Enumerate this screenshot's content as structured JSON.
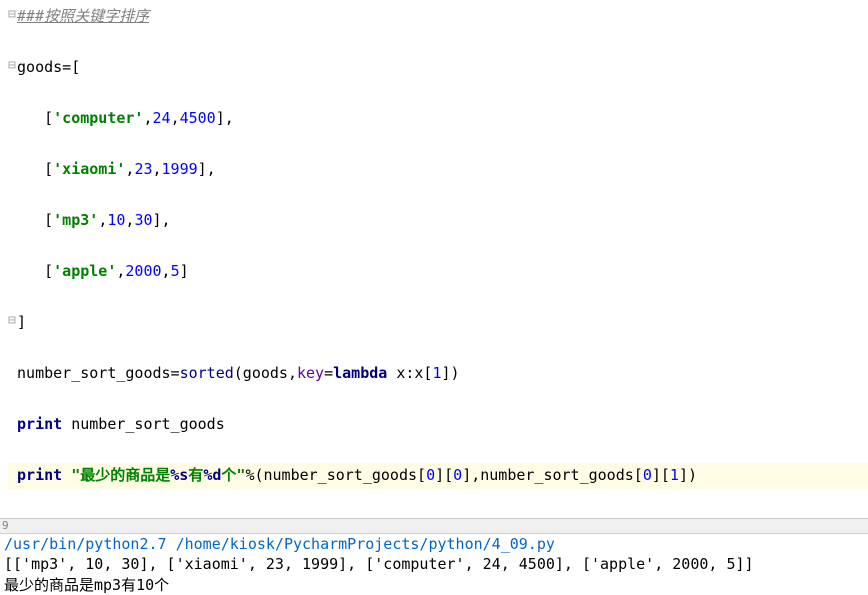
{
  "editor": {
    "comment": "###按照关键字排序",
    "l2a": "goods=[",
    "l3_indent": "    [",
    "l3_s": "'computer'",
    "l3_n1": "24",
    "l3_n2": "4500",
    "l3_close": "],",
    "l4_s": "'xiaomi'",
    "l4_n1": "23",
    "l4_n2": "1999",
    "l5_s": "'mp3'",
    "l5_n1": "10",
    "l5_n2": "30",
    "l6_s": "'apple'",
    "l6_n1": "2000",
    "l6_n2": "5",
    "l6_close": "]",
    "l7": "]",
    "l8_var": "number_sort_goods=",
    "l8_sorted": "sorted",
    "l8_args1": "(goods,",
    "l8_key": "key",
    "l8_eq": "=",
    "l8_lambda": "lambda",
    "l8_rest": " x:x[",
    "l8_idx": "1",
    "l8_end": "])",
    "l9_print": "print",
    "l9_rest": " number_sort_goods",
    "l10_print": "print",
    "l10_sp": " ",
    "l10_str1": "\"最少的商品是",
    "l10_fmt1": "%s",
    "l10_str2": "有",
    "l10_fmt2": "%d",
    "l10_str3": "个\"",
    "l10_pct": "%(number_sort_goods[",
    "l10_z1": "0",
    "l10_b1": "][",
    "l10_z2": "0",
    "l10_b2": "],number_sort_goods[",
    "l10_z3": "0",
    "l10_b3": "][",
    "l10_z4": "1",
    "l10_b4": "])"
  },
  "linenum": "9",
  "console": {
    "cmd": "/usr/bin/python2.7 /home/kiosk/PycharmProjects/python/4_09.py",
    "out1": "[['mp3', 10, 30], ['xiaomi', 23, 1999], ['computer', 24, 4500], ['apple', 2000, 5]]",
    "out2": "最少的商品是mp3有10个"
  }
}
